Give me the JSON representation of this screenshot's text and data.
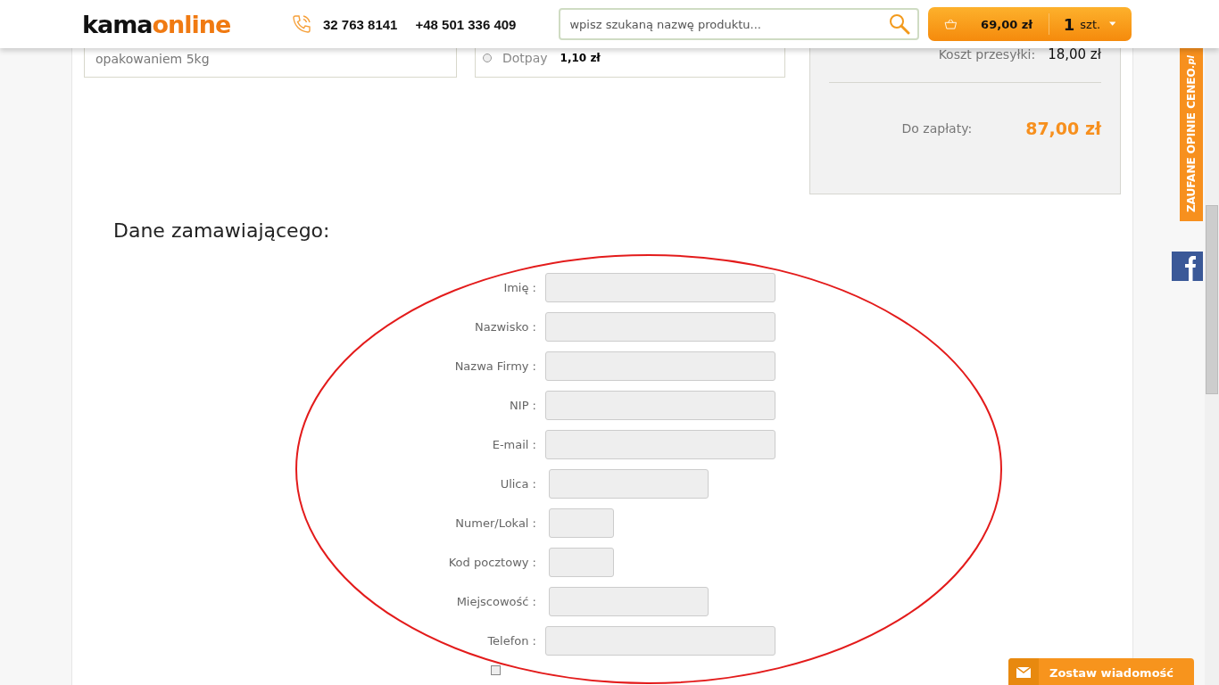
{
  "header": {
    "logo": {
      "part_1": "kama",
      "part_2": "online"
    },
    "phones": [
      "32 763 8141",
      "+48 501 336 409"
    ],
    "search": {
      "placeholder": "wpisz szukaną nazwę produktu..."
    },
    "cart": {
      "total": "69,00 zł",
      "count": "1",
      "unit": "szt."
    }
  },
  "top_cards": {
    "note": "opakowaniem 5kg",
    "payment": {
      "name": "Dotpay",
      "fee": "1,10 zł",
      "selected": false
    }
  },
  "summary": {
    "shipping_label": "Koszt przesyłki:",
    "shipping_value": "18,00 zł",
    "total_label": "Do zapłaty:",
    "total_value": "87,00 zł"
  },
  "form": {
    "title": "Dane zamawiającego:",
    "fields": [
      {
        "label": "Imię :",
        "kind": "long"
      },
      {
        "label": "Nazwisko :",
        "kind": "long"
      },
      {
        "label": "Nazwa Firmy :",
        "kind": "long"
      },
      {
        "label": "NIP :",
        "kind": "long"
      },
      {
        "label": "E-mail :",
        "kind": "long"
      },
      {
        "label": "Ulica :",
        "kind": "medium"
      },
      {
        "label": "Numer/Lokal :",
        "kind": "short"
      },
      {
        "label": "Kod pocztowy :",
        "kind": "short"
      },
      {
        "label": "Miejscowość :",
        "kind": "medium"
      },
      {
        "label": "Telefon :",
        "kind": "long"
      }
    ],
    "consent": {
      "checked": false
    }
  },
  "side": {
    "ceneo": {
      "main": "ZAUFANE OPINIE CENEO",
      "suffix": ".pl"
    }
  },
  "message_button": "Zostaw wiadomość"
}
